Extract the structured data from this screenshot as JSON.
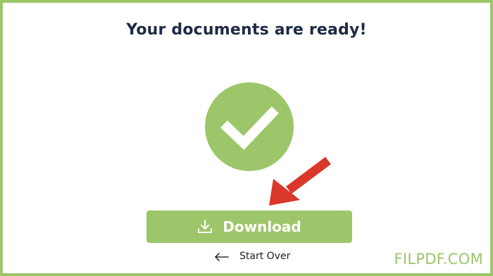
{
  "page": {
    "title": "Your documents are ready!"
  },
  "actions": {
    "download_label": "Download",
    "start_over_label": "Start Over"
  },
  "icons": {
    "success": "check-icon",
    "pointer": "red-arrow-icon",
    "download": "download-icon",
    "back": "arrow-left-icon"
  },
  "colors": {
    "accent": "#9dc66a",
    "title": "#1f2a44",
    "arrow": "#d9382b",
    "button_text": "#ffffff"
  },
  "watermark": {
    "text": "FILPDF.COM"
  }
}
